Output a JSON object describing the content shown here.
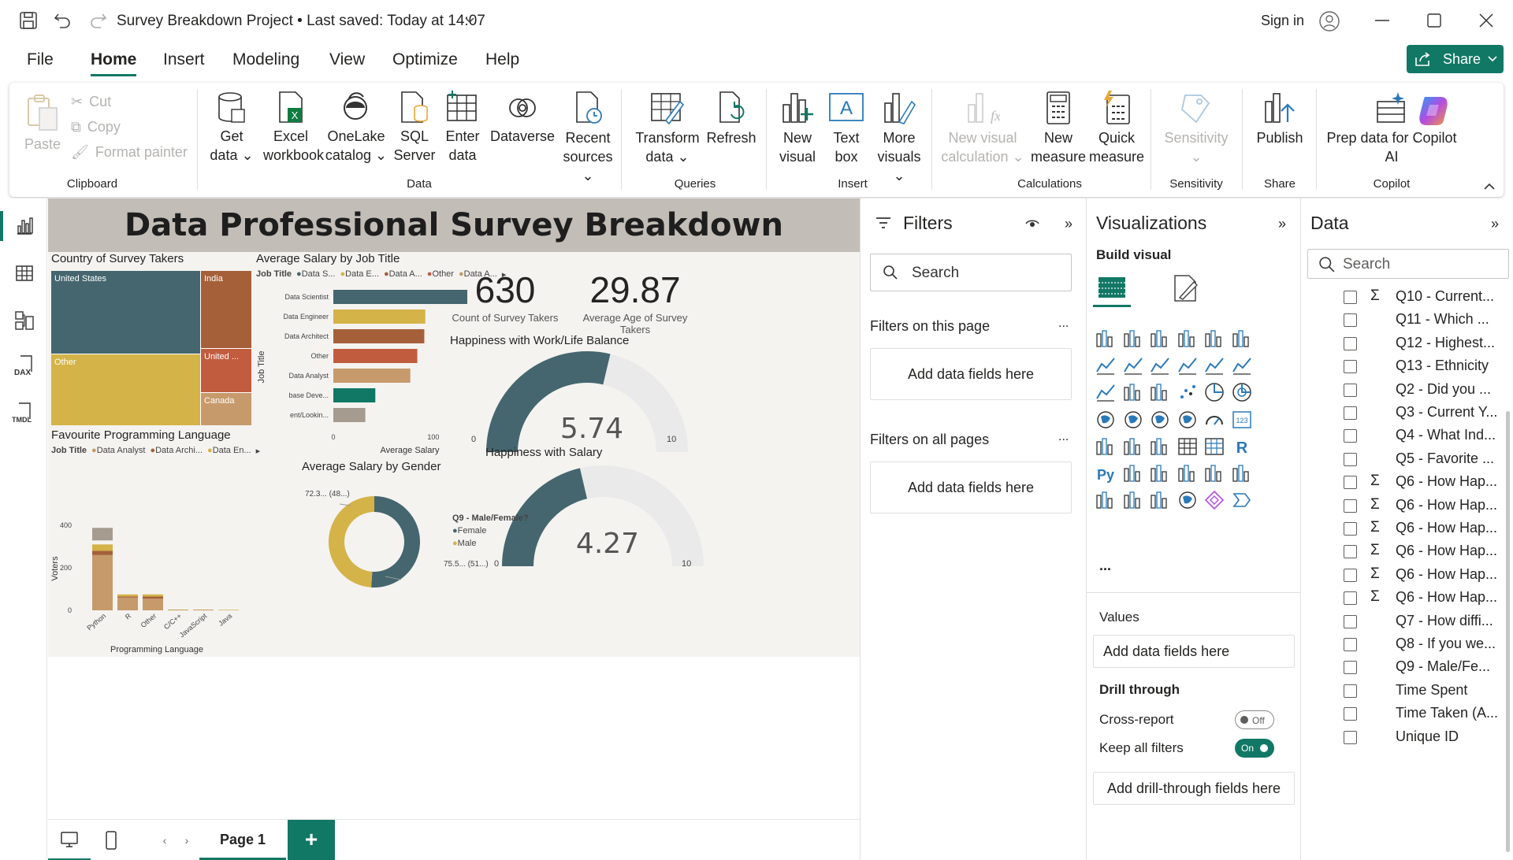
{
  "titlebar": {
    "title": "Survey Breakdown Project • Last saved: Today at 14:07",
    "sign_in": "Sign in"
  },
  "menu": {
    "items": [
      "File",
      "Home",
      "Insert",
      "Modeling",
      "View",
      "Optimize",
      "Help"
    ],
    "active": "Home",
    "share": "Share"
  },
  "ribbon": {
    "clipboard": {
      "paste": "Paste",
      "cut": "Cut",
      "copy": "Copy",
      "format_painter": "Format painter",
      "group": "Clipboard"
    },
    "data": {
      "get_data": [
        "Get",
        "data"
      ],
      "excel": [
        "Excel",
        "workbook"
      ],
      "onelake": [
        "OneLake",
        "catalog"
      ],
      "sql": [
        "SQL",
        "Server"
      ],
      "enter": [
        "Enter",
        "data"
      ],
      "dataverse": "Dataverse",
      "recent": [
        "Recent",
        "sources"
      ],
      "group": "Data"
    },
    "queries": {
      "transform": [
        "Transform",
        "data"
      ],
      "refresh": "Refresh",
      "group": "Queries"
    },
    "insert": {
      "new_visual": [
        "New",
        "visual"
      ],
      "text_box": [
        "Text",
        "box"
      ],
      "more": [
        "More",
        "visuals"
      ],
      "group": "Insert"
    },
    "calculations": {
      "new_visual_calc": [
        "New visual",
        "calculation"
      ],
      "new_measure": [
        "New",
        "measure"
      ],
      "quick_measure": [
        "Quick",
        "measure"
      ],
      "group": "Calculations"
    },
    "sensitivity": {
      "label": "Sensitivity",
      "group": "Sensitivity"
    },
    "share": {
      "publish": "Publish",
      "group": "Share"
    },
    "copilot": {
      "prep": [
        "Prep data for Copilot",
        "AI"
      ],
      "group": "Copilot"
    }
  },
  "report": {
    "title": "Data Professional Survey Breakdown",
    "treemap": {
      "title": "Country of Survey Takers",
      "cells": [
        {
          "label": "United States",
          "value": 34,
          "color": "#45666e"
        },
        {
          "label": "Other",
          "value": 33,
          "color": "#d4b348"
        },
        {
          "label": "India",
          "value": 12,
          "color": "#a5603a"
        },
        {
          "label": "United ...",
          "value": 8,
          "color": "#c25c3e"
        },
        {
          "label": "Canada",
          "value": 5,
          "color": "#c79a6c"
        }
      ]
    },
    "job_salary": {
      "title": "Average Salary by Job Title",
      "legend_title": "Job Title",
      "legend": [
        "Data S...",
        "Data E...",
        "Data A...",
        "Other",
        "Data A..."
      ],
      "ylabel": "Job Title",
      "xlabel": "Average Salary",
      "xticks": [
        "0",
        "100"
      ]
    },
    "kpi1": {
      "value": "630",
      "label": "Count of Survey Takers"
    },
    "kpi2": {
      "value": "29.87",
      "label": "Average Age of Survey Takers"
    },
    "gauge1": {
      "title": "Happiness with Work/Life Balance",
      "value": "5.74",
      "min": "0",
      "max": "10"
    },
    "gauge2": {
      "title": "Happiness with Salary",
      "value": "4.27",
      "min": "0",
      "max": "10"
    },
    "prog_lang": {
      "title": "Favourite Programming Language",
      "legend_title": "Job Title",
      "legend": [
        "Data Analyst",
        "Data Archi...",
        "Data En..."
      ],
      "ylabel": "Voters",
      "xlabel": "Programming Language",
      "yticks": [
        "400",
        "200",
        "0"
      ]
    },
    "gender": {
      "title": "Average Salary by Gender",
      "label_top": "72.3... (48...)",
      "label_bottom": "75.5... (51...)",
      "legend_title": "Q9 - Male/Female?",
      "legend": [
        "Female",
        "Male"
      ]
    }
  },
  "chart_data": [
    {
      "type": "bar",
      "title": "Average Salary by Job Title",
      "categories": [
        "Data Scientist",
        "Data Engineer",
        "Data Architect",
        "Other",
        "Data Analyst",
        "base Deve...",
        "ent/Lookin..."
      ],
      "values": [
        134,
        92,
        91,
        84,
        77,
        42,
        32
      ],
      "colors": [
        "#45666e",
        "#d4b348",
        "#a5603a",
        "#c25c3e",
        "#c79a6c",
        "#117865",
        "#a69b8f"
      ],
      "xlabel": "Average Salary",
      "ylabel": "Job Title"
    },
    {
      "type": "bar",
      "title": "Favourite Programming Language",
      "categories": [
        "Python",
        "R",
        "Other",
        "C/C++",
        "JavaScript",
        "Java"
      ],
      "series": [
        {
          "name": "Data Analyst",
          "values": [
            260,
            60,
            55,
            3,
            3,
            2
          ]
        },
        {
          "name": "Data Archi...",
          "values": [
            20,
            5,
            10,
            0,
            0,
            0
          ]
        },
        {
          "name": "Data En...",
          "values": [
            30,
            10,
            10,
            0,
            0,
            0
          ]
        }
      ],
      "ylim": [
        0,
        400
      ],
      "xlabel": "Programming Language",
      "ylabel": "Voters"
    },
    {
      "type": "pie",
      "title": "Average Salary by Gender",
      "categories": [
        "Female",
        "Male"
      ],
      "values": [
        75.5,
        72.3
      ]
    }
  ],
  "filters": {
    "title": "Filters",
    "search": "Search",
    "on_page": "Filters on this page",
    "on_all": "Filters on all pages",
    "add": "Add data fields here",
    "more": "..."
  },
  "viz": {
    "title": "Visualizations",
    "build": "Build visual",
    "values": "Values",
    "add": "Add data fields here",
    "drill": "Drill through",
    "cross": "Cross-report",
    "cross_state": "Off",
    "keep": "Keep all filters",
    "keep_state": "On",
    "add_drill": "Add drill-through fields here",
    "more": "..."
  },
  "data_pane": {
    "title": "Data",
    "search": "Search",
    "fields": [
      {
        "label": "Q10 - Current...",
        "sigma": true
      },
      {
        "label": "Q11 - Which ...",
        "sigma": false
      },
      {
        "label": "Q12 - Highest...",
        "sigma": false
      },
      {
        "label": "Q13 - Ethnicity",
        "sigma": false
      },
      {
        "label": "Q2 - Did you ...",
        "sigma": false
      },
      {
        "label": "Q3 - Current Y...",
        "sigma": false
      },
      {
        "label": "Q4 - What Ind...",
        "sigma": false
      },
      {
        "label": "Q5 - Favorite ...",
        "sigma": false
      },
      {
        "label": "Q6 - How Hap...",
        "sigma": true
      },
      {
        "label": "Q6 - How Hap...",
        "sigma": true
      },
      {
        "label": "Q6 - How Hap...",
        "sigma": true
      },
      {
        "label": "Q6 - How Hap...",
        "sigma": true
      },
      {
        "label": "Q6 - How Hap...",
        "sigma": true
      },
      {
        "label": "Q6 - How Hap...",
        "sigma": true
      },
      {
        "label": "Q7 - How diffi...",
        "sigma": false
      },
      {
        "label": "Q8 - If you we...",
        "sigma": false
      },
      {
        "label": "Q9 - Male/Fe...",
        "sigma": false
      },
      {
        "label": "Time Spent",
        "sigma": false
      },
      {
        "label": "Time Taken (A...",
        "sigma": false
      },
      {
        "label": "Unique ID",
        "sigma": false
      }
    ]
  },
  "bottom": {
    "page": "Page 1",
    "add": "+"
  }
}
